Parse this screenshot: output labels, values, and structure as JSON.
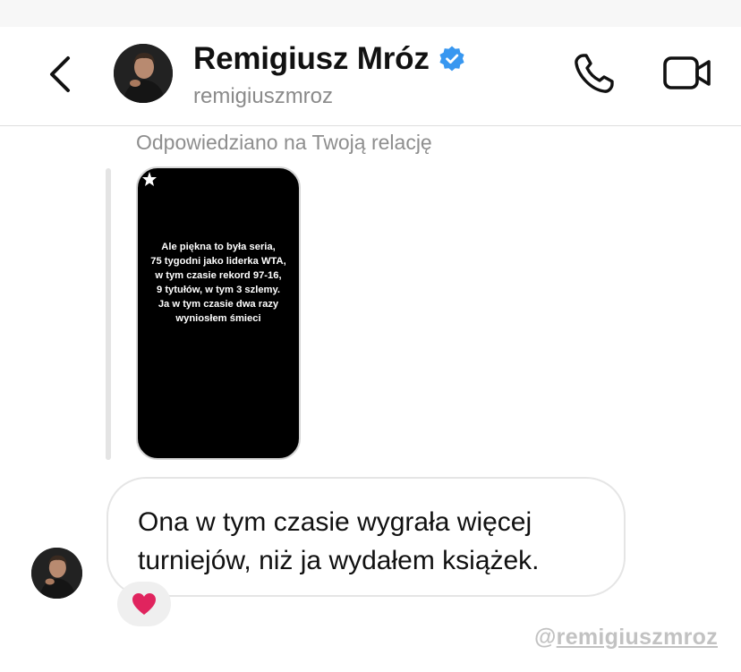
{
  "header": {
    "name": "Remigiusz Mróz",
    "handle": "remigiuszmroz",
    "verified": true,
    "avatar_icon": "profile-photo",
    "back_icon": "chevron-left-icon",
    "call_icon": "phone-icon",
    "video_icon": "video-camera-icon"
  },
  "conversation": {
    "reply_label": "Odpowiedziano na Twoją relację",
    "story": {
      "lines": [
        "Ale piękna to była seria,",
        "75 tygodni jako liderka WTA,",
        "w tym czasie rekord 97-16,",
        "9 tytułów, w tym 3 szlemy.",
        "Ja w tym czasie dwa razy",
        "wyniosłem śmieci"
      ]
    },
    "message": {
      "lines": [
        "Ona w tym czasie wygrała więcej",
        "turniejów, niż ja wydałem książek."
      ],
      "reaction": "❤️"
    }
  },
  "watermark": {
    "at": "@",
    "handle": "remigiuszmroz"
  },
  "colors": {
    "verified_badge": "#3897f0",
    "heart": "#e0245e",
    "bubble_border": "#e5e5e5",
    "muted_text": "#8e8e8e"
  }
}
